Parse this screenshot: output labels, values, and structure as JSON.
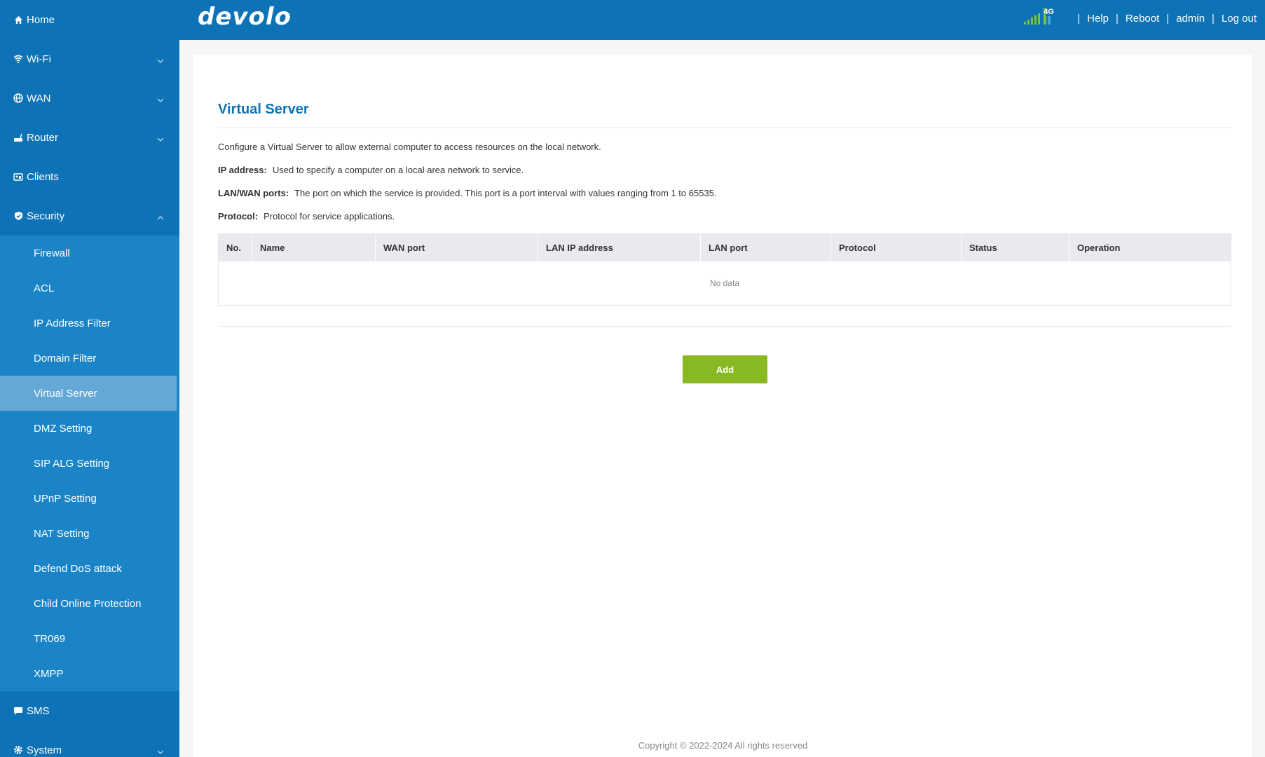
{
  "sidebar": {
    "items": [
      {
        "label": "Home",
        "icon": "home-icon"
      },
      {
        "label": "Wi-Fi",
        "icon": "wifi-icon"
      },
      {
        "label": "WAN",
        "icon": "globe-icon"
      },
      {
        "label": "Router",
        "icon": "router-icon"
      },
      {
        "label": "Clients",
        "icon": "clients-icon"
      },
      {
        "label": "Security",
        "icon": "shield-icon"
      }
    ],
    "security_submenu": [
      "Firewall",
      "ACL",
      "IP Address Filter",
      "Domain Filter",
      "Virtual Server",
      "DMZ Setting",
      "SIP ALG Setting",
      "UPnP Setting",
      "NAT Setting",
      "Defend DoS attack",
      "Child Online Protection",
      "TR069",
      "XMPP"
    ],
    "active_submenu_item": "Virtual Server",
    "bottom_items": [
      {
        "label": "SMS",
        "icon": "sms-icon"
      },
      {
        "label": "System",
        "icon": "gear-icon"
      }
    ]
  },
  "header": {
    "logo": "devolo",
    "network_badge": "4G",
    "links": [
      "Help",
      "Reboot",
      "admin",
      "Log out"
    ],
    "separator": "|"
  },
  "page": {
    "title": "Virtual Server",
    "intro": "Configure a Virtual Server to allow external computer to access resources on the local network.",
    "definitions": [
      {
        "term": "IP address:",
        "text": "Used to specify a computer on a local area network to service."
      },
      {
        "term": "LAN/WAN ports:",
        "text": "The port on which the service is provided. This port is a port interval with values ranging from 1 to 65535."
      },
      {
        "term": "Protocol:",
        "text": "Protocol for service applications."
      }
    ],
    "table": {
      "columns": [
        "No.",
        "Name",
        "WAN port",
        "LAN IP address",
        "LAN port",
        "Protocol",
        "Status",
        "Operation"
      ],
      "empty_text": "No data"
    },
    "add_button": "Add"
  },
  "footer": {
    "copyright": "Copyright © 2022-2024 All rights reserved"
  },
  "colors": {
    "sidebar": "#0d72b6",
    "submenu": "#1a84c7",
    "active": "#64a8d8",
    "accent_green": "#88b823"
  }
}
